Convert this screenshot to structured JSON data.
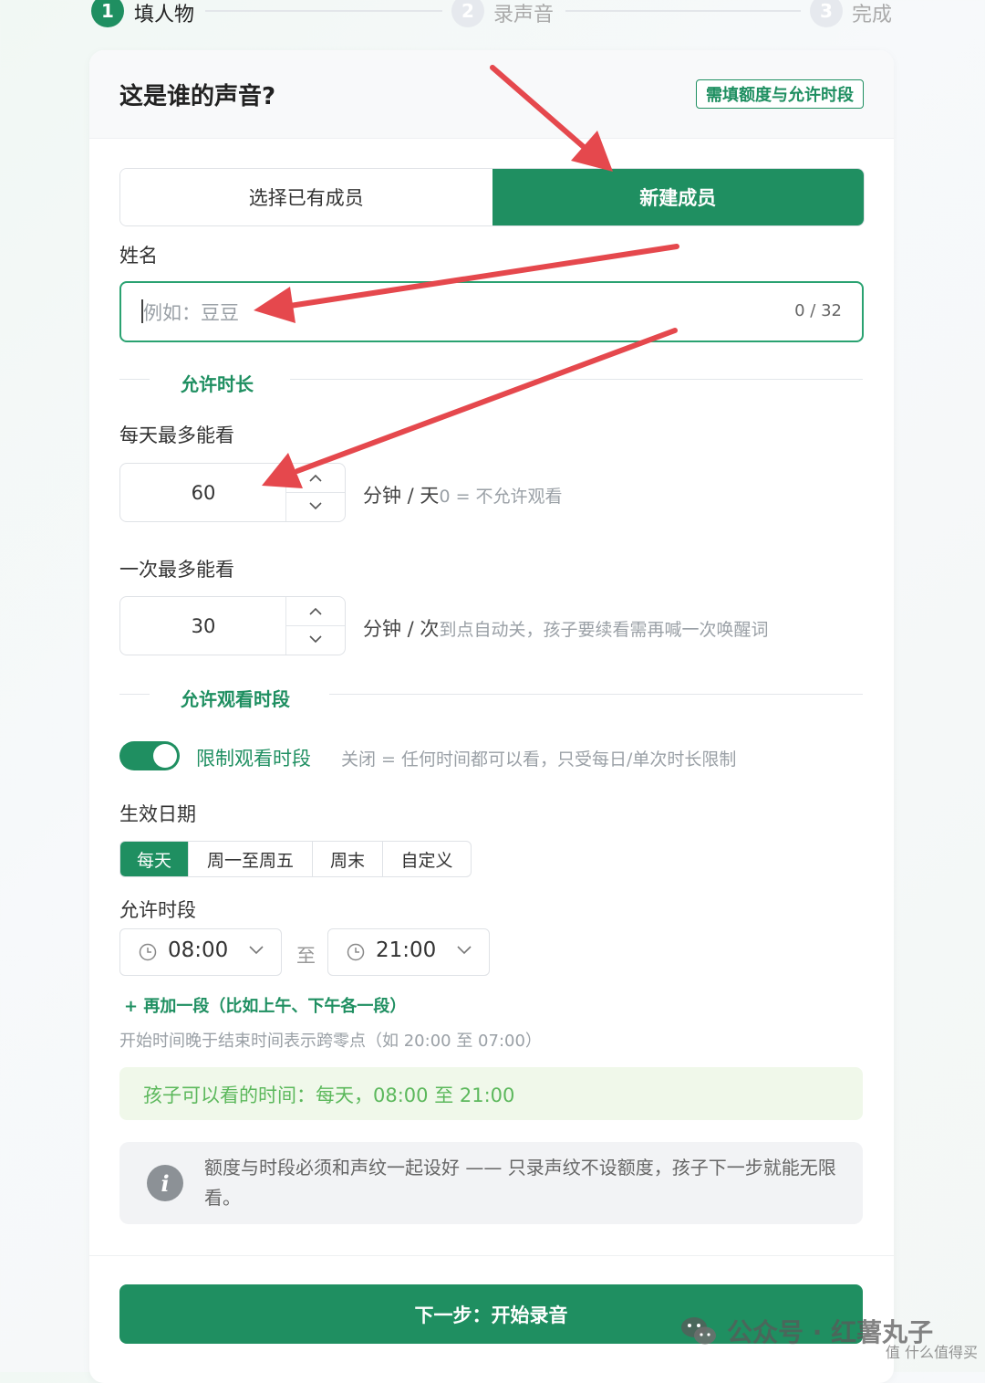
{
  "stepper": {
    "steps": [
      {
        "index": "1",
        "label": "填人物"
      },
      {
        "index": "2",
        "label": "录声音"
      },
      {
        "index": "3",
        "label": "完成"
      }
    ]
  },
  "header": {
    "title": "这是谁的声音?",
    "badge": "需填额度与允许时段"
  },
  "member_mode": {
    "existing": "选择已有成员",
    "new": "新建成员"
  },
  "name": {
    "label": "姓名",
    "placeholder": "例如：豆豆",
    "count": "0 / 32"
  },
  "duration": {
    "section_title": "允许时长",
    "daily_label": "每天最多能看",
    "daily_value": "60",
    "daily_unit": "分钟 / 天",
    "daily_hint": "0 = 不允许观看",
    "session_label": "一次最多能看",
    "session_value": "30",
    "session_unit": "分钟 / 次",
    "session_hint": "到点自动关，孩子要续看需再喊一次唤醒词"
  },
  "period": {
    "section_title": "允许观看时段",
    "toggle_label": "限制观看时段",
    "toggle_hint": "关闭 = 任何时间都可以看，只受每日/单次时长限制",
    "toggle_on": true,
    "date_label": "生效日期",
    "date_tabs": [
      "每天",
      "周一至周五",
      "周末",
      "自定义"
    ],
    "date_selected": "每天",
    "time_label": "允许时段",
    "start": "08:00",
    "to": "至",
    "end": "21:00",
    "add_link": "+ 再加一段（比如上午、下午各一段）",
    "note": "开始时间晚于结束时间表示跨零点（如 20:00 至 07:00）",
    "summary": "孩子可以看的时间：每天，08:00 至 21:00"
  },
  "info": {
    "text": "额度与时段必须和声纹一起设好 —— 只录声纹不设额度，孩子下一步就能无限看。"
  },
  "cta": {
    "label": "下一步：开始录音"
  },
  "watermark": {
    "main": "公众号 · 红薯丸子",
    "sub": "值 什么值得买"
  },
  "colors": {
    "accent": "#1f8f61",
    "arrow": "#e5484d",
    "summary_text": "#5cb85c"
  }
}
